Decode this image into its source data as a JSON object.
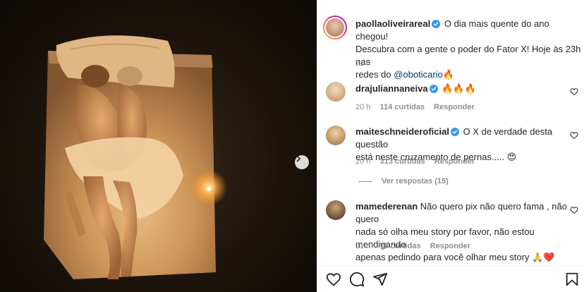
{
  "post": {
    "author": "paollaoliveirareal",
    "caption_line1": "O dia mais quente do ano chegou!",
    "caption_line2": "Descubra com a gente o poder do Fator X! Hoje às 23h nas",
    "caption_line3_prefix": "redes do ",
    "caption_mention": "@oboticario",
    "caption_emoji": "🔥",
    "time": "21 h"
  },
  "comments": [
    {
      "username": "drajuliannaneiva",
      "verified": true,
      "text": "🔥🔥🔥",
      "time": "20 h",
      "likes": "114 curtidas",
      "reply": "Responder"
    },
    {
      "username": "maiteschneideroficial",
      "verified": true,
      "text_line1": "O X de verdade desta questão",
      "text_line2": "está neste cruzamento de pernas..... 😍",
      "time": "20 h",
      "likes": "313 curtidas",
      "reply": "Responder",
      "view_replies": "Ver respostas (15)"
    },
    {
      "username": "mamederenan",
      "verified": false,
      "text_line1": "Não quero pix não quero fama , não quero",
      "text_line2": "nada só olha meu story por favor, não estou mendigando",
      "text_line3": "apenas pedindo para você olhar meu story 🙏❤️",
      "time": "21 h",
      "likes": "78 curtidas",
      "reply": "Responder"
    }
  ],
  "icons": {
    "like": "heart-outline",
    "comment": "speech-bubble",
    "share": "paper-plane",
    "save": "bookmark",
    "next": "chevron-right",
    "verified": "verified-badge"
  },
  "colors": {
    "verified": "#3897f0",
    "link": "#00376b",
    "muted": "#8e8e8e"
  }
}
